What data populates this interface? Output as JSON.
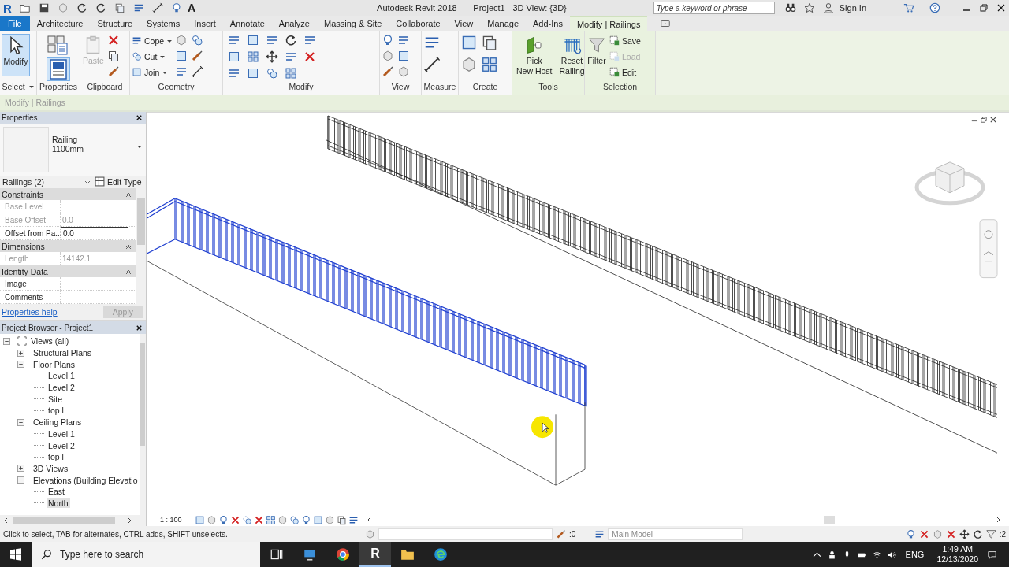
{
  "app": {
    "logo": "R",
    "text_tool": "A"
  },
  "window": {
    "app_title": "Autodesk Revit 2018 -",
    "doc_title": "Project1 - 3D View: {3D}"
  },
  "search": {
    "placeholder": "Type a keyword or phrase"
  },
  "account": {
    "label": "Sign In"
  },
  "ribbon_tabs": [
    {
      "label": "File",
      "kind": "file",
      "selected": false
    },
    {
      "label": "Architecture",
      "kind": "normal",
      "selected": false
    },
    {
      "label": "Structure",
      "kind": "normal",
      "selected": false
    },
    {
      "label": "Systems",
      "kind": "normal",
      "selected": false
    },
    {
      "label": "Insert",
      "kind": "normal",
      "selected": false
    },
    {
      "label": "Annotate",
      "kind": "normal",
      "selected": false
    },
    {
      "label": "Analyze",
      "kind": "normal",
      "selected": false
    },
    {
      "label": "Massing & Site",
      "kind": "normal",
      "selected": false
    },
    {
      "label": "Collaborate",
      "kind": "normal",
      "selected": false
    },
    {
      "label": "View",
      "kind": "normal",
      "selected": false
    },
    {
      "label": "Manage",
      "kind": "normal",
      "selected": false
    },
    {
      "label": "Add-Ins",
      "kind": "normal",
      "selected": false
    },
    {
      "label": "Modify | Railings",
      "kind": "contextual",
      "selected": true
    }
  ],
  "ribbon_panels": [
    {
      "label": "Select",
      "contextual": false,
      "tools": [
        {
          "label": "Modify",
          "disabled": false,
          "active": true
        }
      ]
    },
    {
      "label": "Properties",
      "contextual": false
    },
    {
      "label": "Clipboard",
      "contextual": false,
      "tools": [
        {
          "label": "Paste",
          "disabled": true
        }
      ]
    },
    {
      "label": "Geometry",
      "contextual": false,
      "tools": [
        {
          "label": "Cope",
          "disabled": false
        },
        {
          "label": "Cut",
          "disabled": false
        },
        {
          "label": "Join",
          "disabled": false
        }
      ]
    },
    {
      "label": "Modify",
      "contextual": false
    },
    {
      "label": "View",
      "contextual": false
    },
    {
      "label": "Measure",
      "contextual": false
    },
    {
      "label": "Create",
      "contextual": false
    },
    {
      "label": "Tools",
      "contextual": true,
      "tools": [
        {
          "label": "Pick\nNew Host",
          "disabled": false
        },
        {
          "label": "Reset\nRailing",
          "disabled": false
        }
      ]
    },
    {
      "label": "Selection",
      "contextual": true,
      "tools": [
        {
          "label": "Filter",
          "disabled": false
        },
        {
          "label": "Save",
          "disabled": false
        },
        {
          "label": "Load",
          "disabled": true
        },
        {
          "label": "Edit",
          "disabled": false
        }
      ]
    }
  ],
  "context_bar": {
    "label": "Modify | Railings"
  },
  "properties": {
    "title": "Properties",
    "type_name": "Railing",
    "type_size": "1100mm",
    "filter": "Railings (2)",
    "edit_type": "Edit Type",
    "groups": [
      {
        "name": "Constraints",
        "rows": [
          {
            "name": "Base Level",
            "disabled": true,
            "editing": false
          },
          {
            "name": "Base Offset",
            "value": "0.0",
            "disabled": true,
            "editing": false
          },
          {
            "name": "Offset from Pa...",
            "value": "0.0",
            "disabled": false,
            "editing": true
          }
        ]
      },
      {
        "name": "Dimensions",
        "rows": [
          {
            "name": "Length",
            "value": "14142.1",
            "disabled": true,
            "editing": false
          }
        ]
      },
      {
        "name": "Identity Data",
        "rows": [
          {
            "name": "Image",
            "disabled": false,
            "editing": false
          },
          {
            "name": "Comments",
            "disabled": false,
            "editing": false
          }
        ]
      }
    ],
    "help": "Properties help",
    "apply": {
      "label": "Apply",
      "disabled": true
    }
  },
  "browser": {
    "title": "Project Browser - Project1",
    "tree": [
      {
        "label": "Views (all)",
        "expanded": true,
        "selected": false,
        "children": [
          {
            "label": "Structural Plans",
            "expanded": false,
            "selected": false
          },
          {
            "label": "Floor Plans",
            "expanded": true,
            "selected": false,
            "children": [
              {
                "label": "Level 1",
                "selected": false
              },
              {
                "label": "Level 2",
                "selected": false
              },
              {
                "label": "Site",
                "selected": false
              },
              {
                "label": "top l",
                "selected": false
              }
            ]
          },
          {
            "label": "Ceiling Plans",
            "expanded": true,
            "selected": false,
            "children": [
              {
                "label": "Level 1",
                "selected": false
              },
              {
                "label": "Level 2",
                "selected": false
              },
              {
                "label": "top l",
                "selected": false
              }
            ]
          },
          {
            "label": "3D Views",
            "expanded": false,
            "selected": false
          },
          {
            "label": "Elevations (Building Elevatio",
            "expanded": true,
            "selected": false,
            "children": [
              {
                "label": "East",
                "selected": false
              },
              {
                "label": "North",
                "selected": true
              }
            ]
          }
        ]
      }
    ]
  },
  "model": {
    "railings": [
      {
        "selected": true
      },
      {
        "selected": false
      }
    ]
  },
  "view_bar": {
    "scale": "1 : 100"
  },
  "status_bar": {
    "message": "Click to select, TAB for alternates, CTRL adds, SHIFT unselects.",
    "active_only": ":0",
    "workset": "Main Model",
    "filter_count": ":2"
  },
  "taskbar": {
    "search_placeholder": "Type here to search",
    "revit_letter": "R",
    "language": "ENG",
    "time": "1:49 AM",
    "date": "12/13/2020"
  }
}
